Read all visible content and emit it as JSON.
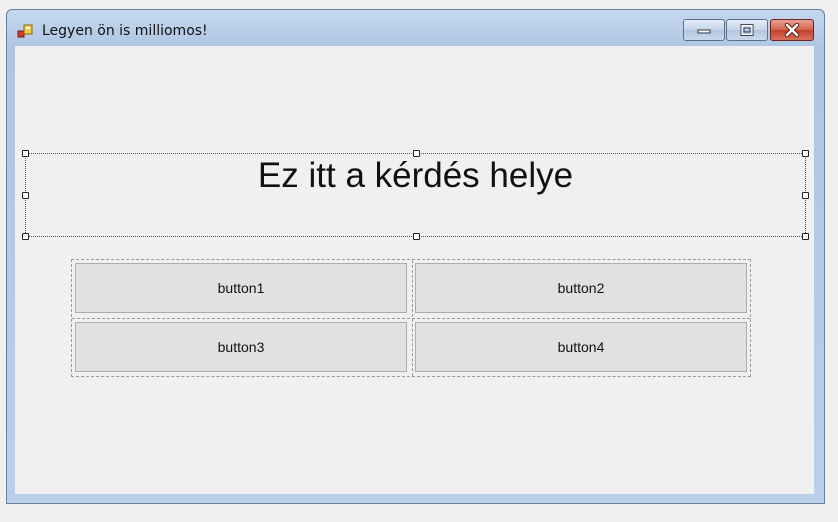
{
  "window": {
    "title": "Legyen ön is milliomos!",
    "caption_buttons": [
      "minimize-icon",
      "maximize-icon",
      "close-icon"
    ]
  },
  "form": {
    "question_label": "Ez itt a kérdés helye",
    "buttons": [
      "button1",
      "button2",
      "button3",
      "button4"
    ]
  },
  "colors": {
    "titlebar": "#aec6e3",
    "client_background": "#f0f0f0",
    "button_face": "#e1e1e1",
    "close_button": "#c9472f"
  }
}
